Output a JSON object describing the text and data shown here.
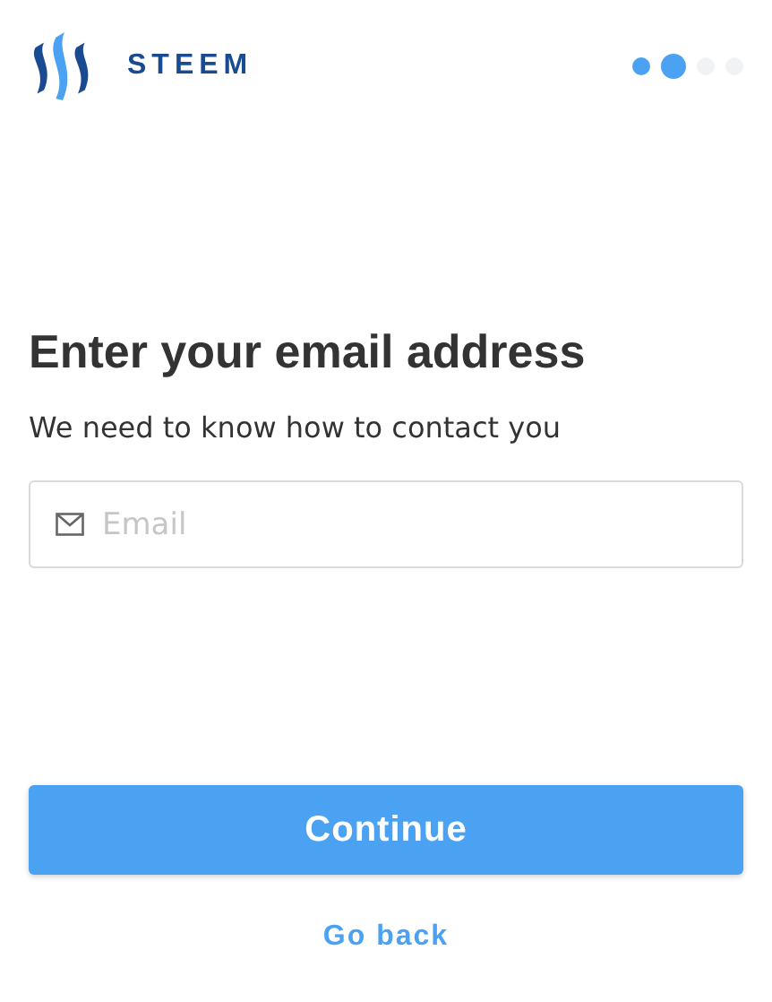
{
  "brand": "STEEM",
  "steps": [
    {
      "done": true,
      "selected": false
    },
    {
      "done": true,
      "selected": true
    },
    {
      "done": false,
      "selected": false
    },
    {
      "done": false,
      "selected": false
    }
  ],
  "title": "Enter your email address",
  "subtitle": "We need to know how to contact you",
  "email_field": {
    "placeholder": "Email"
  },
  "primary_button": "Continue",
  "back_link": "Go back"
}
